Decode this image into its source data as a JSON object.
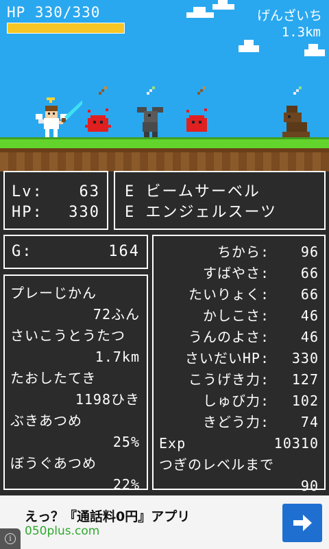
{
  "hud": {
    "hp_text": "HP 330/330",
    "hp_ratio": 1.0,
    "stage_name": "げんざいち",
    "distance": "1.3km"
  },
  "level_panel": {
    "level_label": "Lv:",
    "level_value": "63",
    "hp_label": "HP:",
    "hp_value": "330"
  },
  "equipment": [
    {
      "mark": "E",
      "name": "ビームサーベル"
    },
    {
      "mark": "E",
      "name": "エンジェルスーツ"
    }
  ],
  "gold": {
    "label": "G:",
    "value": "164"
  },
  "records": [
    {
      "label": "プレーじかん",
      "value": "72ふん"
    },
    {
      "label": "さいこうとうたつ",
      "value": "1.7km"
    },
    {
      "label": "たおしたてき",
      "value": "1198ひき"
    },
    {
      "label": "ぶきあつめ",
      "value": "25%"
    },
    {
      "label": "ぼうぐあつめ",
      "value": "22%"
    }
  ],
  "stats": [
    {
      "label": "ちから:",
      "value": "96"
    },
    {
      "label": "すばやさ:",
      "value": "66"
    },
    {
      "label": "たいりょく:",
      "value": "66"
    },
    {
      "label": "かしこさ:",
      "value": "46"
    },
    {
      "label": "うんのよさ:",
      "value": "46"
    },
    {
      "label": "さいだいHP:",
      "value": "330"
    },
    {
      "label": "こうげき力:",
      "value": "127"
    },
    {
      "label": "しゅび力:",
      "value": "102"
    },
    {
      "label": "きどう力:",
      "value": "74"
    }
  ],
  "exp": {
    "label": "Exp",
    "value": "10310"
  },
  "next_level": {
    "label": "つぎのレベルまで",
    "value": "90"
  },
  "ad": {
    "title": "えっ？『通話料0円』アプリ",
    "url": "050plus.com",
    "arrow_icon": "arrow-right-icon",
    "info_icon": "info-icon",
    "info_symbol": "i"
  },
  "colors": {
    "sky": "#29a8ef",
    "hp_bar": "#f7c526",
    "panel_bg": "#2b2b2b",
    "grass": "#63d42c",
    "ad_button": "#1f6fd1",
    "ad_url": "#2ea82e"
  }
}
